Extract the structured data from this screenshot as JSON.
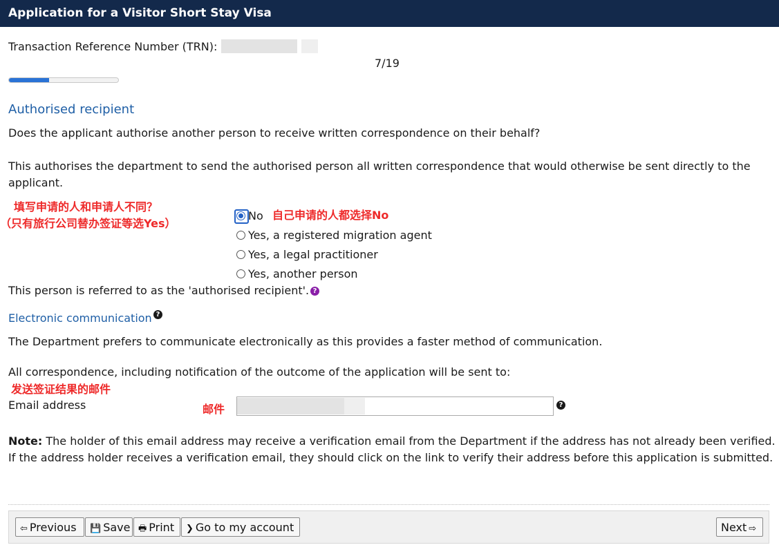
{
  "window": {
    "title": "Application for a Visitor Short Stay Visa"
  },
  "trn": {
    "label": "Transaction Reference Number (TRN):"
  },
  "progress": {
    "text": "7/19",
    "fraction": 0.368
  },
  "section1": {
    "heading": "Authorised recipient",
    "question": "Does the applicant authorise another person to receive written correspondence on their behalf?",
    "info_line1": "This authorises the department to send the authorised person all written correspondence that would otherwise be sent directly to the",
    "info_line2": "applicant.",
    "options": [
      {
        "label": "No",
        "selected": true
      },
      {
        "label": "Yes, a registered migration agent",
        "selected": false
      },
      {
        "label": "Yes, a legal practitioner",
        "selected": false
      },
      {
        "label": "Yes, another person",
        "selected": false
      }
    ],
    "referred": "This person is referred to as the 'authorised recipient'."
  },
  "annotations": {
    "left_line1": "填写申请的人和申请人不同？",
    "left_line2": "（只有旅行公司替办签证等选Yes）",
    "right_no": "自己申请的人都选择No",
    "email_result": "发送签证结果的邮件",
    "email_label": "邮件",
    "color": "#ee2a2a"
  },
  "section2": {
    "heading": "Electronic communication",
    "prefers": "The Department prefers to communicate electronically as this provides a faster method of communication.",
    "all_corr": "All correspondence, including notification of the outcome of the application will be sent to:",
    "email_label": "Email address",
    "note_label": "Note:",
    "note_line1": " The holder of this email address may receive a verification email from the Department if the address has not already been verified.",
    "note_line2": "If the address holder receives a verification email, they should click on the link to verify their address before this application is submitted."
  },
  "footer": {
    "previous": "Previous",
    "save": "Save",
    "print": "Print",
    "account": "Go to my account",
    "next": "Next"
  },
  "icons": {
    "previous": "arrow-left-icon",
    "save": "floppy-icon",
    "print": "printer-icon",
    "account": "chevron-right-icon",
    "next": "arrow-right-icon",
    "help": "question-icon"
  },
  "colors": {
    "title_bar": "#13294b",
    "heading": "#1f5fa6",
    "progress": "#2a73d6",
    "help_purple": "#8a1fa8"
  }
}
